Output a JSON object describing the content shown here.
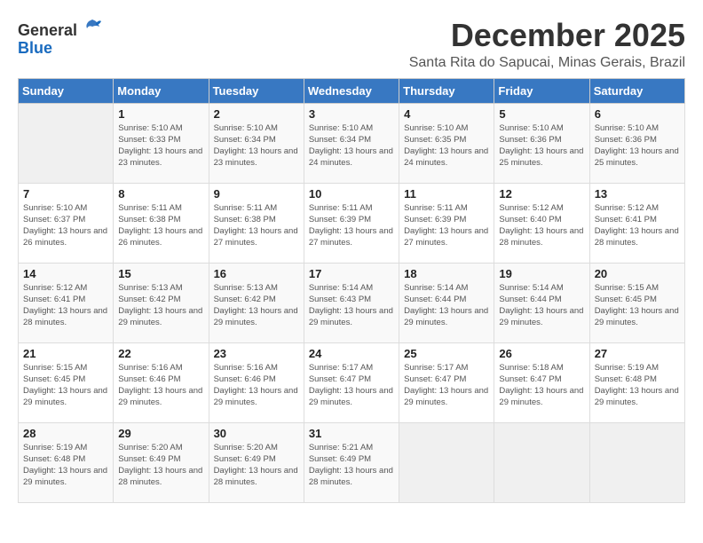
{
  "logo": {
    "general": "General",
    "blue": "Blue"
  },
  "calendar": {
    "title": "December 2025",
    "subtitle": "Santa Rita do Sapucai, Minas Gerais, Brazil"
  },
  "weekdays": [
    "Sunday",
    "Monday",
    "Tuesday",
    "Wednesday",
    "Thursday",
    "Friday",
    "Saturday"
  ],
  "weeks": [
    [
      {
        "day": "",
        "info": ""
      },
      {
        "day": "1",
        "info": "Sunrise: 5:10 AM\nSunset: 6:33 PM\nDaylight: 13 hours and 23 minutes."
      },
      {
        "day": "2",
        "info": "Sunrise: 5:10 AM\nSunset: 6:34 PM\nDaylight: 13 hours and 23 minutes."
      },
      {
        "day": "3",
        "info": "Sunrise: 5:10 AM\nSunset: 6:34 PM\nDaylight: 13 hours and 24 minutes."
      },
      {
        "day": "4",
        "info": "Sunrise: 5:10 AM\nSunset: 6:35 PM\nDaylight: 13 hours and 24 minutes."
      },
      {
        "day": "5",
        "info": "Sunrise: 5:10 AM\nSunset: 6:36 PM\nDaylight: 13 hours and 25 minutes."
      },
      {
        "day": "6",
        "info": "Sunrise: 5:10 AM\nSunset: 6:36 PM\nDaylight: 13 hours and 25 minutes."
      }
    ],
    [
      {
        "day": "7",
        "info": "Sunrise: 5:10 AM\nSunset: 6:37 PM\nDaylight: 13 hours and 26 minutes."
      },
      {
        "day": "8",
        "info": "Sunrise: 5:11 AM\nSunset: 6:38 PM\nDaylight: 13 hours and 26 minutes."
      },
      {
        "day": "9",
        "info": "Sunrise: 5:11 AM\nSunset: 6:38 PM\nDaylight: 13 hours and 27 minutes."
      },
      {
        "day": "10",
        "info": "Sunrise: 5:11 AM\nSunset: 6:39 PM\nDaylight: 13 hours and 27 minutes."
      },
      {
        "day": "11",
        "info": "Sunrise: 5:11 AM\nSunset: 6:39 PM\nDaylight: 13 hours and 27 minutes."
      },
      {
        "day": "12",
        "info": "Sunrise: 5:12 AM\nSunset: 6:40 PM\nDaylight: 13 hours and 28 minutes."
      },
      {
        "day": "13",
        "info": "Sunrise: 5:12 AM\nSunset: 6:41 PM\nDaylight: 13 hours and 28 minutes."
      }
    ],
    [
      {
        "day": "14",
        "info": "Sunrise: 5:12 AM\nSunset: 6:41 PM\nDaylight: 13 hours and 28 minutes."
      },
      {
        "day": "15",
        "info": "Sunrise: 5:13 AM\nSunset: 6:42 PM\nDaylight: 13 hours and 29 minutes."
      },
      {
        "day": "16",
        "info": "Sunrise: 5:13 AM\nSunset: 6:42 PM\nDaylight: 13 hours and 29 minutes."
      },
      {
        "day": "17",
        "info": "Sunrise: 5:14 AM\nSunset: 6:43 PM\nDaylight: 13 hours and 29 minutes."
      },
      {
        "day": "18",
        "info": "Sunrise: 5:14 AM\nSunset: 6:44 PM\nDaylight: 13 hours and 29 minutes."
      },
      {
        "day": "19",
        "info": "Sunrise: 5:14 AM\nSunset: 6:44 PM\nDaylight: 13 hours and 29 minutes."
      },
      {
        "day": "20",
        "info": "Sunrise: 5:15 AM\nSunset: 6:45 PM\nDaylight: 13 hours and 29 minutes."
      }
    ],
    [
      {
        "day": "21",
        "info": "Sunrise: 5:15 AM\nSunset: 6:45 PM\nDaylight: 13 hours and 29 minutes."
      },
      {
        "day": "22",
        "info": "Sunrise: 5:16 AM\nSunset: 6:46 PM\nDaylight: 13 hours and 29 minutes."
      },
      {
        "day": "23",
        "info": "Sunrise: 5:16 AM\nSunset: 6:46 PM\nDaylight: 13 hours and 29 minutes."
      },
      {
        "day": "24",
        "info": "Sunrise: 5:17 AM\nSunset: 6:47 PM\nDaylight: 13 hours and 29 minutes."
      },
      {
        "day": "25",
        "info": "Sunrise: 5:17 AM\nSunset: 6:47 PM\nDaylight: 13 hours and 29 minutes."
      },
      {
        "day": "26",
        "info": "Sunrise: 5:18 AM\nSunset: 6:47 PM\nDaylight: 13 hours and 29 minutes."
      },
      {
        "day": "27",
        "info": "Sunrise: 5:19 AM\nSunset: 6:48 PM\nDaylight: 13 hours and 29 minutes."
      }
    ],
    [
      {
        "day": "28",
        "info": "Sunrise: 5:19 AM\nSunset: 6:48 PM\nDaylight: 13 hours and 29 minutes."
      },
      {
        "day": "29",
        "info": "Sunrise: 5:20 AM\nSunset: 6:49 PM\nDaylight: 13 hours and 28 minutes."
      },
      {
        "day": "30",
        "info": "Sunrise: 5:20 AM\nSunset: 6:49 PM\nDaylight: 13 hours and 28 minutes."
      },
      {
        "day": "31",
        "info": "Sunrise: 5:21 AM\nSunset: 6:49 PM\nDaylight: 13 hours and 28 minutes."
      },
      {
        "day": "",
        "info": ""
      },
      {
        "day": "",
        "info": ""
      },
      {
        "day": "",
        "info": ""
      }
    ]
  ]
}
